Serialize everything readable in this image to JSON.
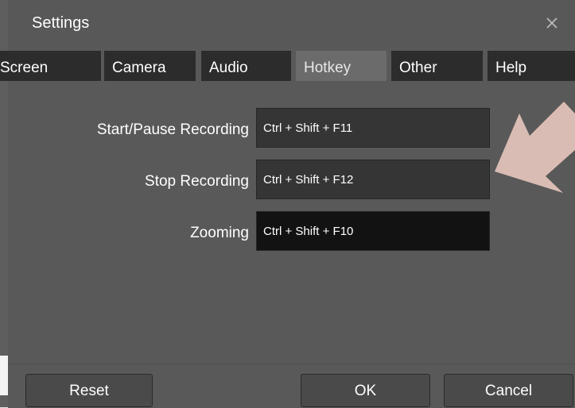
{
  "window": {
    "title": "Settings",
    "close_icon": "close-icon"
  },
  "tabs": [
    {
      "label": "Screen",
      "active": false
    },
    {
      "label": "Camera",
      "active": false
    },
    {
      "label": "Audio",
      "active": false
    },
    {
      "label": "Hotkey",
      "active": true
    },
    {
      "label": "Other",
      "active": false
    },
    {
      "label": "Help",
      "active": false
    }
  ],
  "hotkeys": [
    {
      "label": "Start/Pause Recording",
      "value": "Ctrl + Shift + F11"
    },
    {
      "label": "Stop Recording",
      "value": "Ctrl + Shift + F12"
    },
    {
      "label": "Zooming",
      "value": "Ctrl + Shift + F10"
    }
  ],
  "footer": {
    "reset_label": "Reset",
    "ok_label": "OK",
    "cancel_label": "Cancel"
  },
  "colors": {
    "window_bg": "#595959",
    "tab_bg": "#2c2c2c",
    "tab_active_bg": "#6b6b6b",
    "field_bg": "#353535",
    "field_focused_bg": "#121212",
    "arrow": "#d9bcb3"
  }
}
